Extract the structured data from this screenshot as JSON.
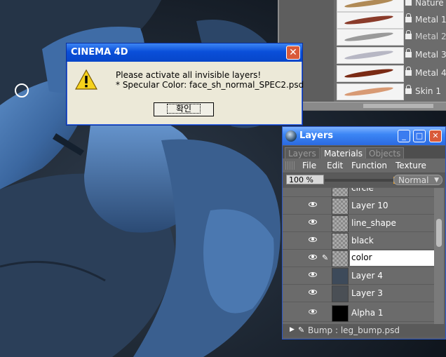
{
  "colors": {
    "xp_title_blue": "#0a4fd9",
    "dialog_face": "#ece9d8",
    "palette_bg": "#5e5e5e",
    "model_blue": "#3c6ea8"
  },
  "brush_panel": {
    "items": [
      {
        "label": "Nature",
        "swatch": "#b08a56"
      },
      {
        "label": "Metal 1",
        "swatch": "#8a3b2a"
      },
      {
        "label": "Metal 2",
        "swatch": "#9a9a9a"
      },
      {
        "label": "Metal 3",
        "swatch": "#b7b7c4"
      },
      {
        "label": "Metal 4",
        "swatch": "#7a2a14"
      },
      {
        "label": "Skin 1",
        "swatch": "#d89a74"
      }
    ]
  },
  "dialog": {
    "title": "CINEMA 4D",
    "close_glyph": "✕",
    "icon": "warning-icon",
    "message_line1": "Please activate all invisible layers!",
    "message_line2": "* Specular Color: face_sh_normal_SPEC2.psd",
    "ok_label": "확인"
  },
  "layers_palette": {
    "title": "Layers",
    "minimize": "_",
    "maximize": "□",
    "close": "✕",
    "tabs": [
      "Layers",
      "Materials",
      "Objects"
    ],
    "active_tab": "Materials",
    "menu": [
      "File",
      "Edit",
      "Function",
      "Texture"
    ],
    "opacity": "100 %",
    "blend_mode": "Normal",
    "rows": [
      {
        "name": "circle"
      },
      {
        "name": "Layer 10"
      },
      {
        "name": "line_shape"
      },
      {
        "name": "black"
      },
      {
        "name": "color",
        "selected": true
      },
      {
        "name": "Layer 4"
      },
      {
        "name": "Layer 3"
      },
      {
        "name": "Alpha 1"
      }
    ],
    "footer": "Bump : leg_bump.psd"
  }
}
